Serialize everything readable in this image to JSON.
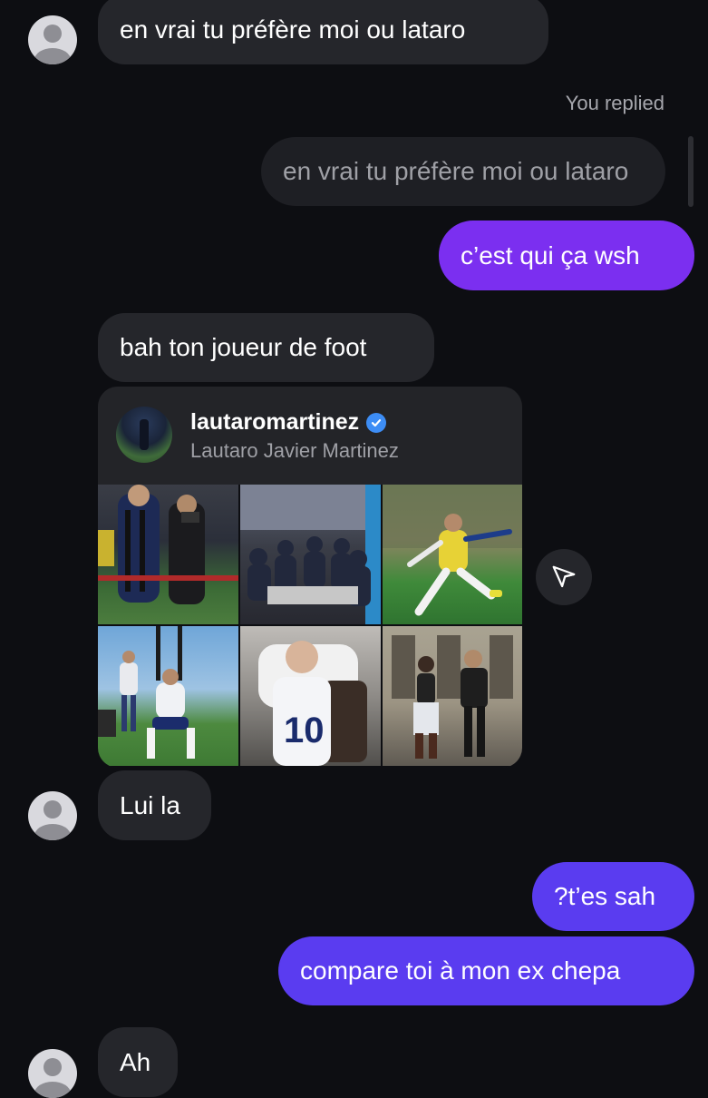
{
  "messages": {
    "m1": "en vrai tu préfère moi ou lataro",
    "replied_label": "You replied",
    "quoted": "en vrai tu préfère moi ou lataro",
    "reply": "c’est qui ça wsh",
    "m2": "bah ton joueur de foot",
    "m3": "Lui la",
    "m4": "?t’es sah",
    "m5": "compare toi à mon ex chepa",
    "m6": "Ah"
  },
  "shared_post": {
    "username": "lautaromartinez",
    "full_name": "Lautaro Javier Martinez",
    "photos": [
      "photo-player-interviewed",
      "photo-team-dinner",
      "photo-player-kicking",
      "photo-player-training",
      "photo-child-jersey",
      "photo-couple-walking"
    ]
  },
  "icons": {
    "avatar": "default-user-icon",
    "verified": "verified-badge-icon",
    "share": "send-paper-plane-icon"
  },
  "colors": {
    "background": "#0d0e12",
    "incoming_bubble": "#25262b",
    "outgoing_purple": "#7b2ff0",
    "outgoing_indigo": "#5a3cf0",
    "verified_blue": "#3d8df5"
  }
}
